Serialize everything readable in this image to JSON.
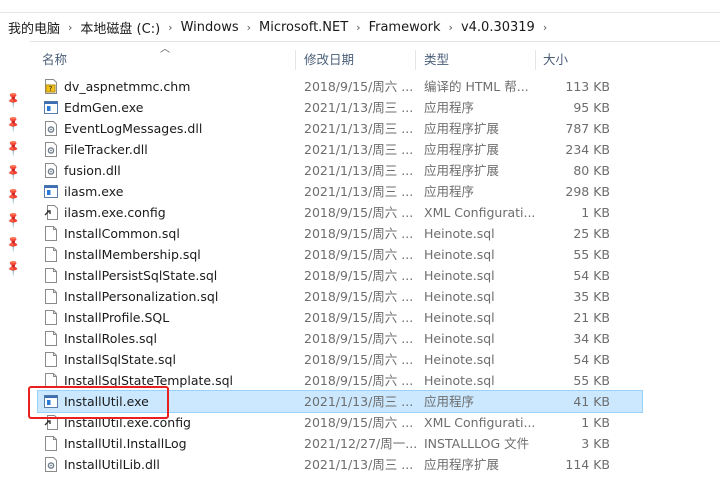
{
  "breadcrumb": [
    "我的电脑",
    "本地磁盘 (C:)",
    "Windows",
    "Microsoft.NET",
    "Framework",
    "v4.0.30319"
  ],
  "columns": {
    "name": "名称",
    "date": "修改日期",
    "type": "类型",
    "size": "大小"
  },
  "top_partial": "dv_aspnetmmc.chm",
  "files": [
    {
      "name": "dv_aspnetmmc.chm",
      "date": "2018/9/15/周六 ...",
      "type": "编译的 HTML 帮...",
      "size": "113 KB",
      "icon": "chm-help-icon"
    },
    {
      "name": "EdmGen.exe",
      "date": "2021/1/13/周三 ...",
      "type": "应用程序",
      "size": "95 KB",
      "icon": "exe-app-icon"
    },
    {
      "name": "EventLogMessages.dll",
      "date": "2021/1/13/周三 ...",
      "type": "应用程序扩展",
      "size": "787 KB",
      "icon": "dll-gear-icon"
    },
    {
      "name": "FileTracker.dll",
      "date": "2021/1/13/周三 ...",
      "type": "应用程序扩展",
      "size": "234 KB",
      "icon": "dll-gear-icon"
    },
    {
      "name": "fusion.dll",
      "date": "2021/1/13/周三 ...",
      "type": "应用程序扩展",
      "size": "80 KB",
      "icon": "dll-gear-icon"
    },
    {
      "name": "ilasm.exe",
      "date": "2021/1/13/周三 ...",
      "type": "应用程序",
      "size": "298 KB",
      "icon": "exe-app-icon"
    },
    {
      "name": "ilasm.exe.config",
      "date": "2018/9/15/周六 ...",
      "type": "XML Configurati...",
      "size": "1 KB",
      "icon": "config-file-icon"
    },
    {
      "name": "InstallCommon.sql",
      "date": "2018/9/15/周六 ...",
      "type": "Heinote.sql",
      "size": "25 KB",
      "icon": "blank-file-icon"
    },
    {
      "name": "InstallMembership.sql",
      "date": "2018/9/15/周六 ...",
      "type": "Heinote.sql",
      "size": "55 KB",
      "icon": "blank-file-icon"
    },
    {
      "name": "InstallPersistSqlState.sql",
      "date": "2018/9/15/周六 ...",
      "type": "Heinote.sql",
      "size": "54 KB",
      "icon": "blank-file-icon"
    },
    {
      "name": "InstallPersonalization.sql",
      "date": "2018/9/15/周六 ...",
      "type": "Heinote.sql",
      "size": "35 KB",
      "icon": "blank-file-icon"
    },
    {
      "name": "InstallProfile.SQL",
      "date": "2018/9/15/周六 ...",
      "type": "Heinote.sql",
      "size": "21 KB",
      "icon": "blank-file-icon"
    },
    {
      "name": "InstallRoles.sql",
      "date": "2018/9/15/周六 ...",
      "type": "Heinote.sql",
      "size": "34 KB",
      "icon": "blank-file-icon"
    },
    {
      "name": "InstallSqlState.sql",
      "date": "2018/9/15/周六 ...",
      "type": "Heinote.sql",
      "size": "54 KB",
      "icon": "blank-file-icon"
    },
    {
      "name": "InstallSqlStateTemplate.sql",
      "date": "2018/9/15/周六 ...",
      "type": "Heinote.sql",
      "size": "55 KB",
      "icon": "blank-file-icon"
    },
    {
      "name": "InstallUtil.exe",
      "date": "2021/1/13/周三 ...",
      "type": "应用程序",
      "size": "41 KB",
      "icon": "exe-app-icon",
      "selected": true
    },
    {
      "name": "InstallUtil.exe.config",
      "date": "2018/9/15/周六 ...",
      "type": "XML Configurati...",
      "size": "1 KB",
      "icon": "config-file-icon"
    },
    {
      "name": "InstallUtil.InstallLog",
      "date": "2021/12/27/周一...",
      "type": "INSTALLLOG 文件",
      "size": "3 KB",
      "icon": "blank-file-icon"
    },
    {
      "name": "InstallUtilLib.dll",
      "date": "2021/1/13/周三 ...",
      "type": "应用程序扩展",
      "size": "114 KB",
      "icon": "dll-gear-icon"
    }
  ],
  "colors": {
    "selection": "#cce8ff",
    "highlight_box": "#e8201f",
    "header_text": "#4c607a"
  }
}
